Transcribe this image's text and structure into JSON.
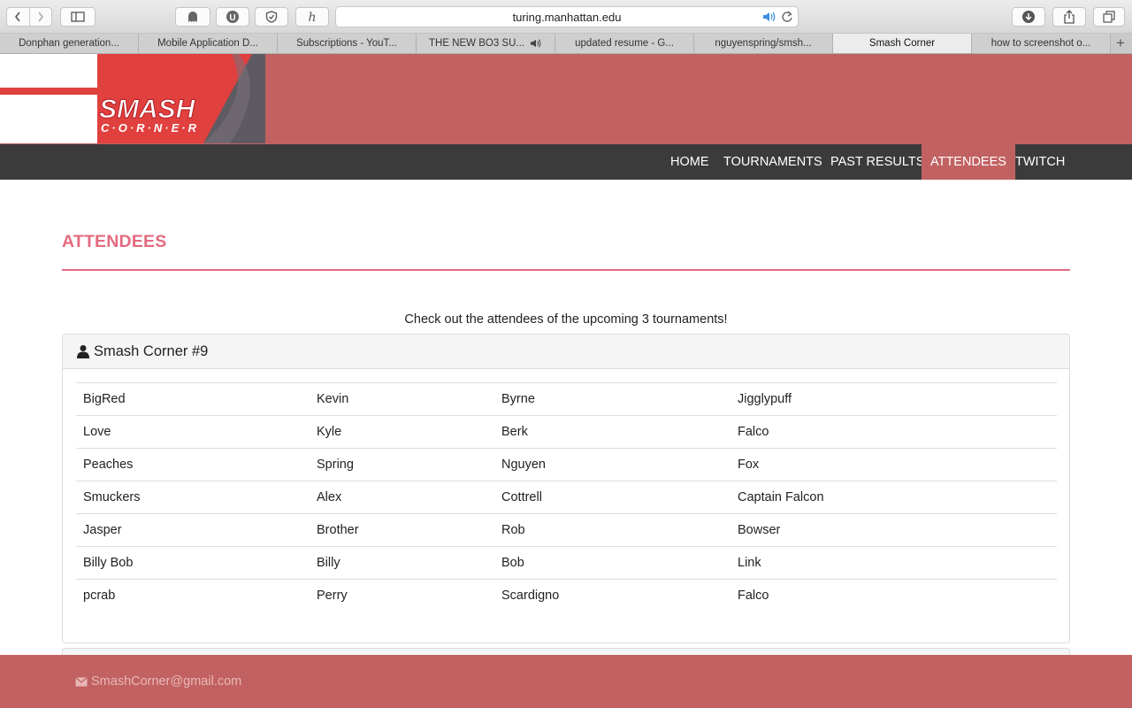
{
  "browser": {
    "url": "turing.manhattan.edu",
    "tabs": [
      {
        "title": "Donphan generation..."
      },
      {
        "title": "Mobile Application D..."
      },
      {
        "title": "Subscriptions - YouT..."
      },
      {
        "title": "THE NEW BO3 SU...",
        "audio": true
      },
      {
        "title": "updated resume - G..."
      },
      {
        "title": "nguyenspring/smsh..."
      },
      {
        "title": "Smash Corner",
        "active": true
      },
      {
        "title": "how to screenshot o..."
      }
    ]
  },
  "site": {
    "logo_text": "SMASH",
    "logo_subtext": "C·O·R·N·E·R",
    "nav": [
      {
        "label": "HOME"
      },
      {
        "label": "TOURNAMENTS"
      },
      {
        "label": "PAST RESULTS"
      },
      {
        "label": "ATTENDEES",
        "active": true
      },
      {
        "label": "TWITCH"
      }
    ],
    "accent_color": "#c26161",
    "title_color": "#e36a80"
  },
  "main": {
    "title": "ATTENDEES",
    "intro": "Check out the attendees of the upcoming 3 tournaments!",
    "tournaments": [
      {
        "name": "Smash Corner #9",
        "rows": [
          [
            "BigRed",
            "Kevin",
            "Byrne",
            "Jigglypuff"
          ],
          [
            "Love",
            "Kyle",
            "Berk",
            "Falco"
          ],
          [
            "Peaches",
            "Spring",
            "Nguyen",
            "Fox"
          ],
          [
            "Smuckers",
            "Alex",
            "Cottrell",
            "Captain Falcon"
          ],
          [
            "Jasper",
            "Brother",
            "Rob",
            "Bowser"
          ],
          [
            "Billy Bob",
            "Billy",
            "Bob",
            "Link"
          ],
          [
            "pcrab",
            "Perry",
            "Scardigno",
            "Falco"
          ]
        ]
      }
    ]
  },
  "footer": {
    "email": "SmashCorner@gmail.com"
  }
}
